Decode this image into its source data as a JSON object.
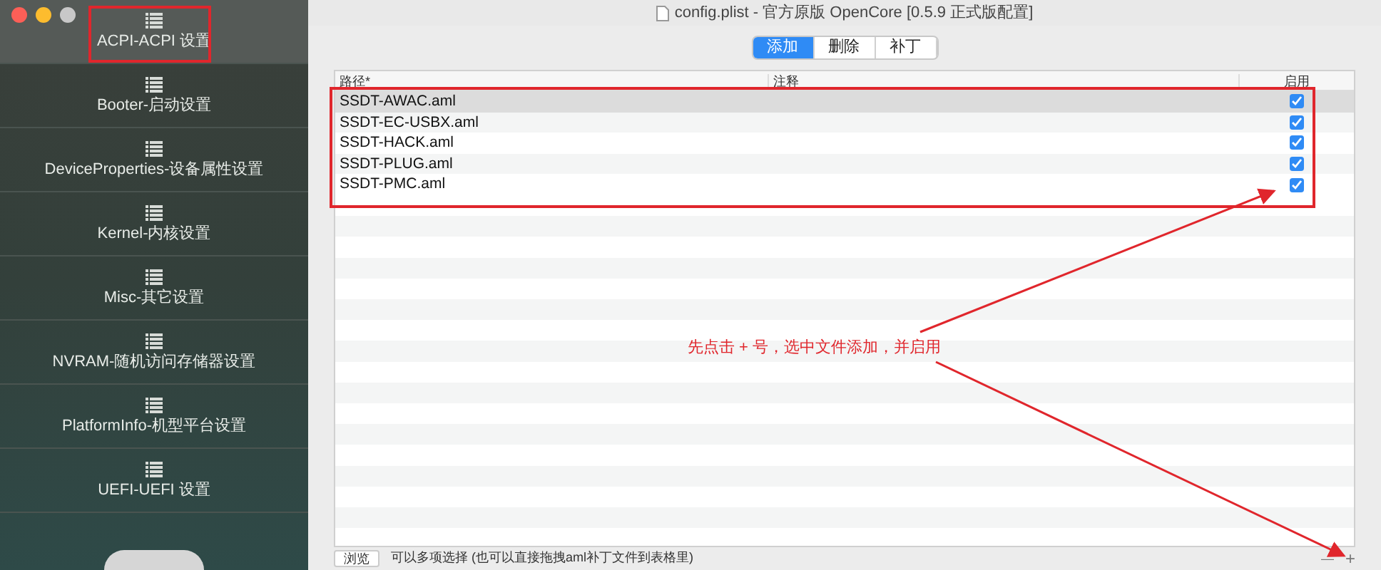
{
  "window": {
    "title": "config.plist - 官方原版 OpenCore [0.5.9 正式版配置]"
  },
  "sidebar": {
    "items": [
      {
        "label": "ACPI-ACPI 设置",
        "selected": true
      },
      {
        "label": "Booter-启动设置",
        "selected": false
      },
      {
        "label": "DeviceProperties-设备属性设置",
        "selected": false
      },
      {
        "label": "Kernel-内核设置",
        "selected": false
      },
      {
        "label": "Misc-其它设置",
        "selected": false
      },
      {
        "label": "NVRAM-随机访问存储器设置",
        "selected": false
      },
      {
        "label": "PlatformInfo-机型平台设置",
        "selected": false
      },
      {
        "label": "UEFI-UEFI 设置",
        "selected": false
      }
    ]
  },
  "tabs": [
    {
      "label": "添加",
      "selected": true
    },
    {
      "label": "删除",
      "selected": false
    },
    {
      "label": "补丁",
      "selected": false
    }
  ],
  "table": {
    "columns": [
      "路径*",
      "注释",
      "启用"
    ],
    "rows": [
      {
        "path": "SSDT-AWAC.aml",
        "enabled": true,
        "selected": true
      },
      {
        "path": "SSDT-EC-USBX.aml",
        "enabled": true,
        "selected": false
      },
      {
        "path": "SSDT-HACK.aml",
        "enabled": true,
        "selected": false
      },
      {
        "path": "SSDT-PLUG.aml",
        "enabled": true,
        "selected": false
      },
      {
        "path": "SSDT-PMC.aml",
        "enabled": true,
        "selected": false
      }
    ]
  },
  "bottom_bar": {
    "browse_button": "浏览",
    "hint": "可以多项选择 (也可以直接拖拽aml补丁文件到表格里)",
    "remove_button": "—",
    "add_button": "+"
  },
  "annotation": {
    "text": "先点击 + 号，选中文件添加，并启用"
  }
}
